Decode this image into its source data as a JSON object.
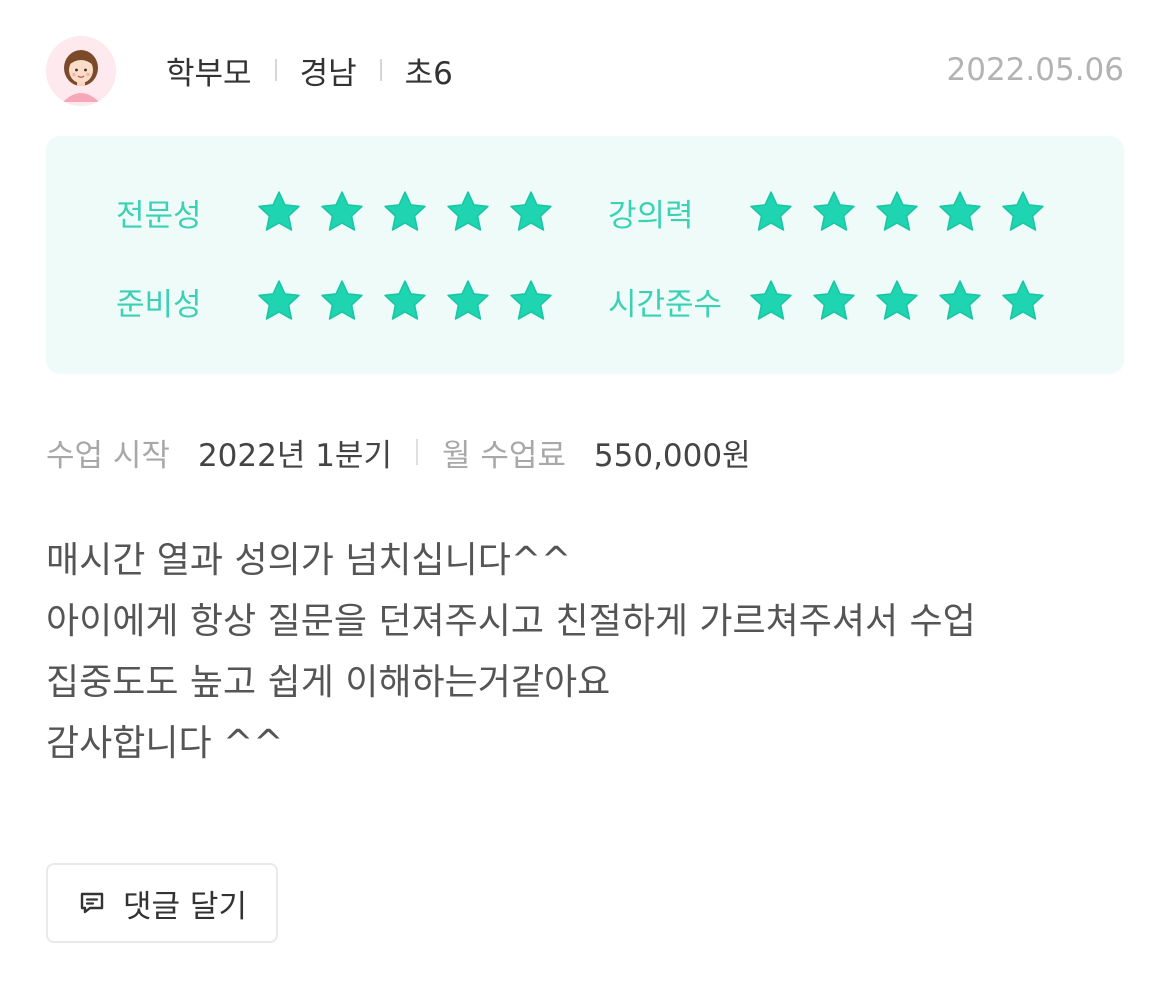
{
  "author": {
    "avatar": "parent-avatar-icon",
    "role": "학부모",
    "region": "경남",
    "grade": "초6"
  },
  "date": "2022.05.06",
  "colors": {
    "accent": "#3bd1b5",
    "star": "#1fd4b0",
    "ratings_bg": "#effbf8"
  },
  "ratings": [
    {
      "label": "전문성",
      "stars": 5,
      "max": 5
    },
    {
      "label": "강의력",
      "stars": 5,
      "max": 5
    },
    {
      "label": "준비성",
      "stars": 5,
      "max": 5
    },
    {
      "label": "시간준수",
      "stars": 5,
      "max": 5
    }
  ],
  "class_info": {
    "start_label": "수업 시작",
    "start_value": "2022년 1분기",
    "fee_label": "월 수업료",
    "fee_value": "550,000원"
  },
  "review": {
    "lines": [
      "매시간 열과 성의가 넘치십니다^^",
      "아이에게 항상 질문을 던져주시고 친절하게 가르쳐주셔서 수업",
      "집중도도 높고 쉽게 이해하는거같아요",
      "감사합니다 ^^"
    ]
  },
  "comment_button": {
    "icon": "comment-icon",
    "label": "댓글 달기"
  }
}
